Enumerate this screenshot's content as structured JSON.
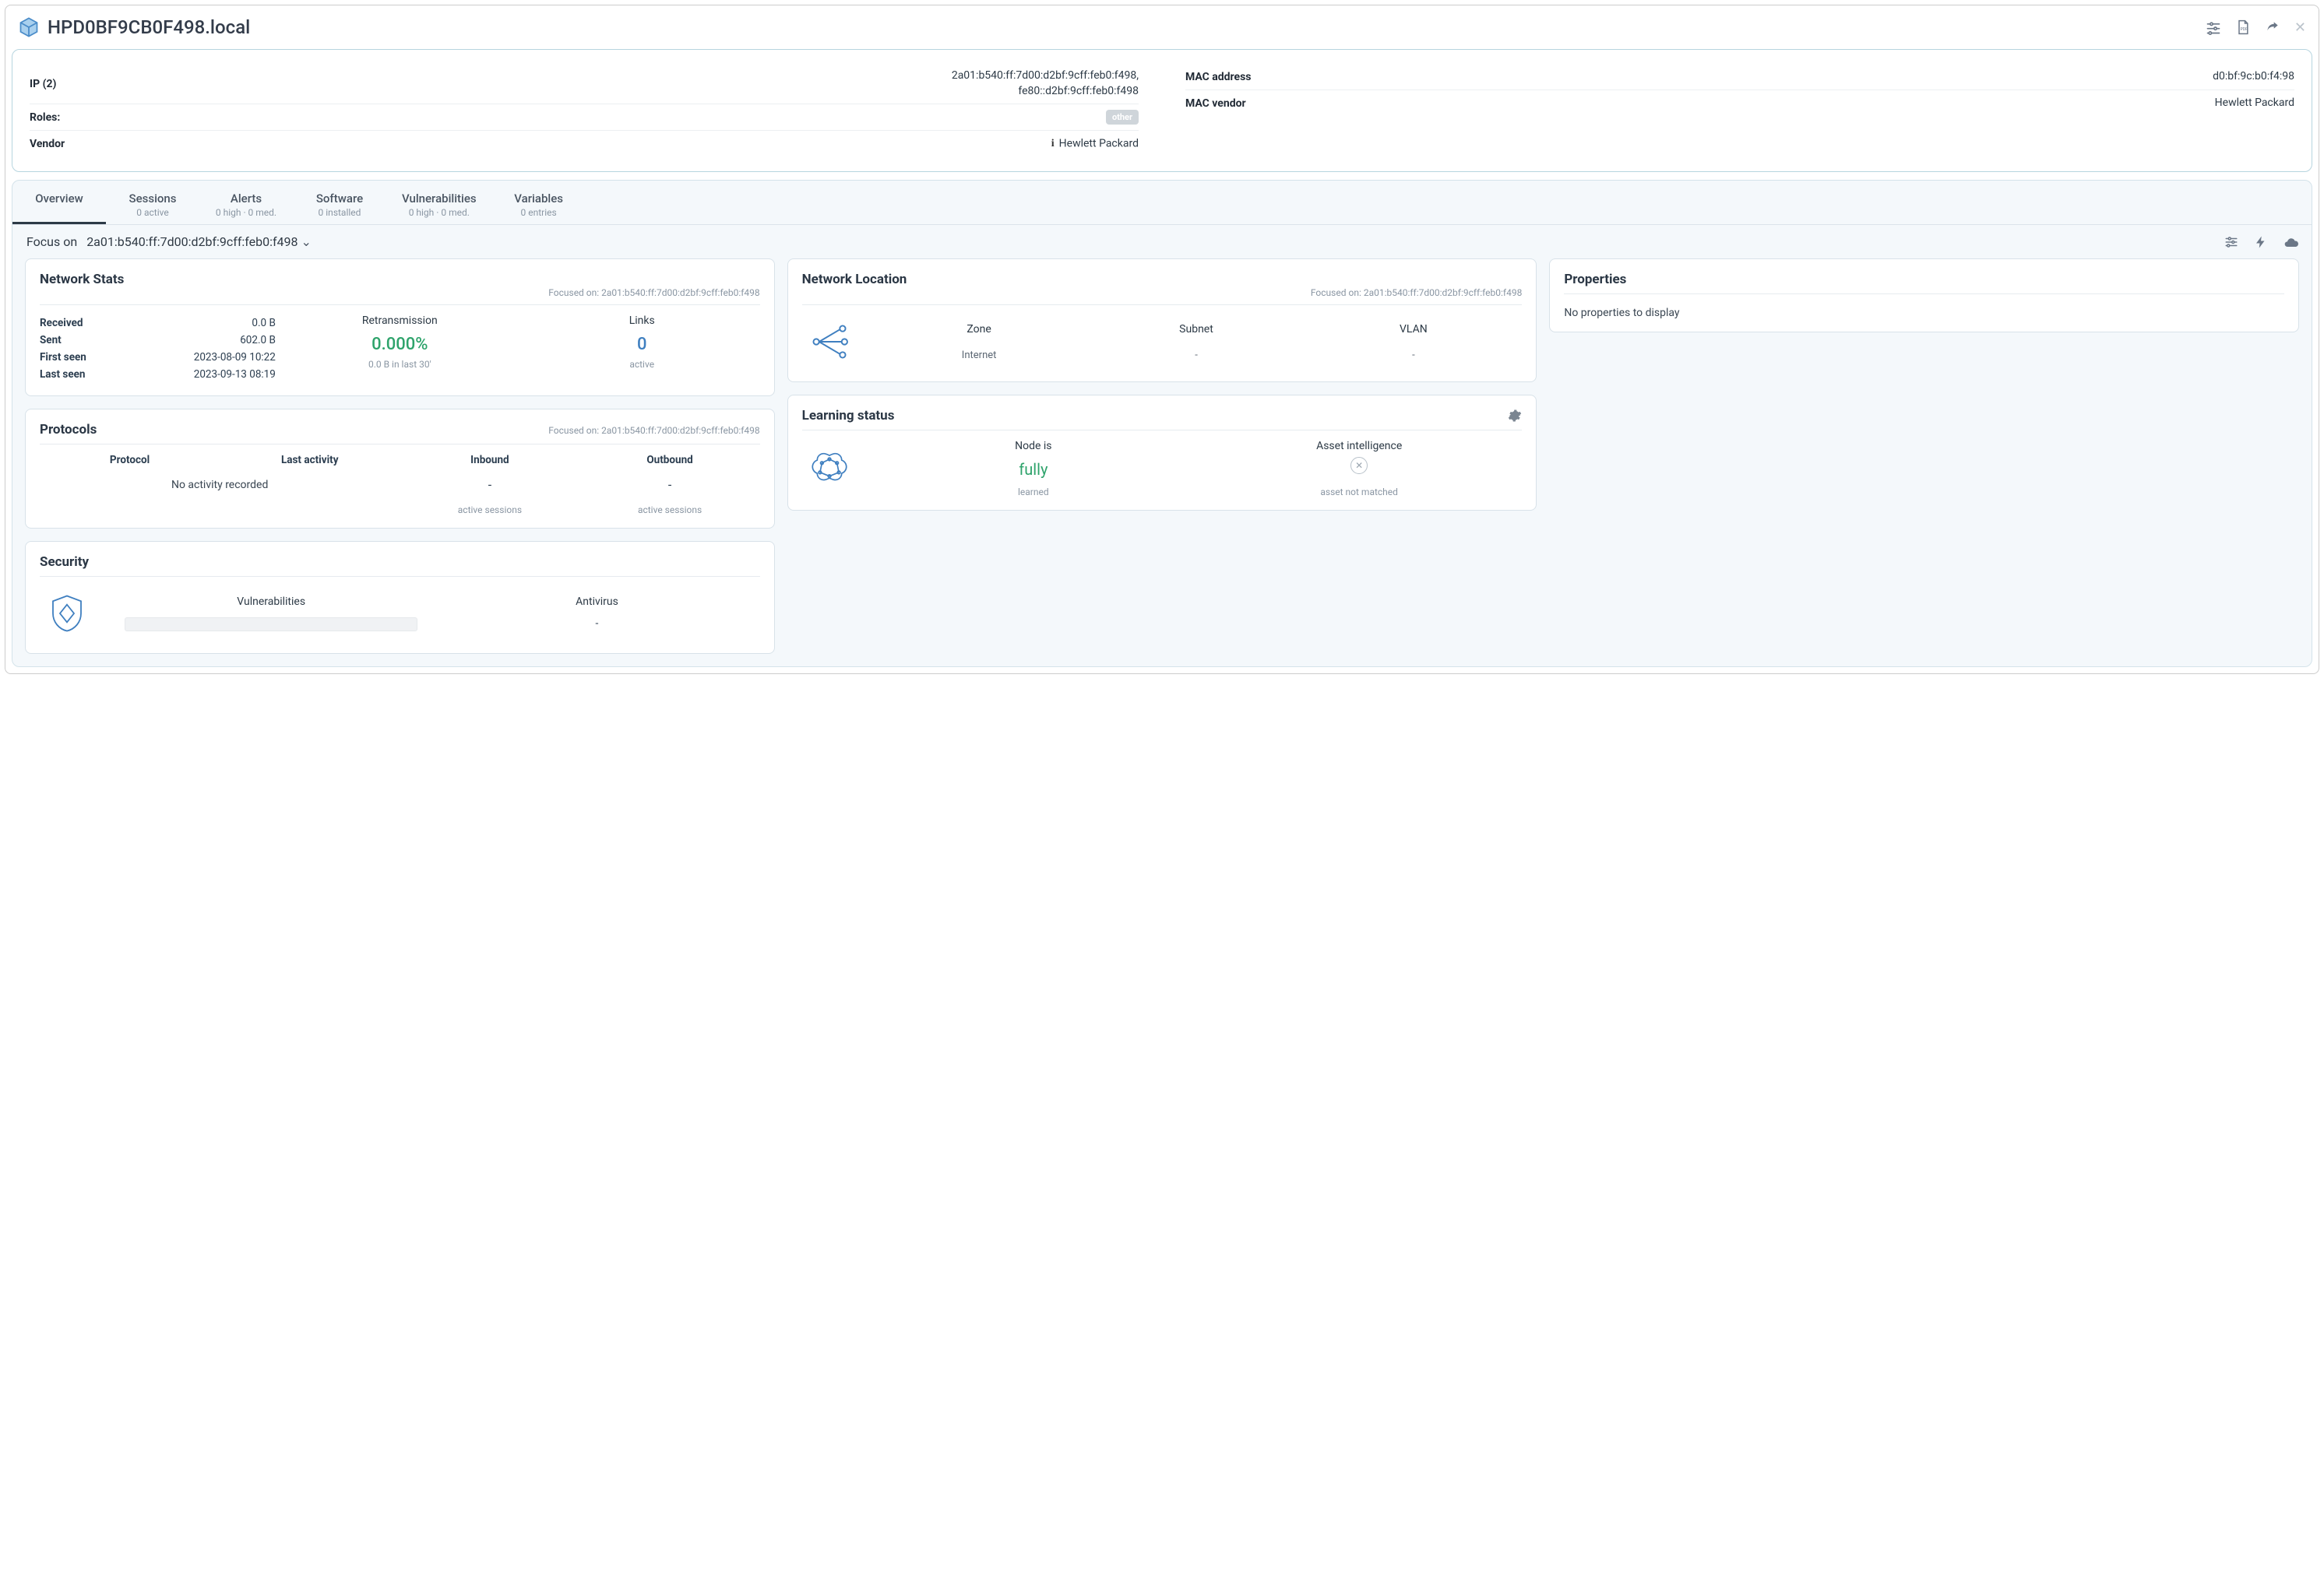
{
  "header": {
    "title": "HPD0BF9CB0F498.local"
  },
  "info": {
    "ip_label": "IP (2)",
    "ip_value": "2a01:b540:ff:7d00:d2bf:9cff:feb0:f498,\nfe80::d2bf:9cff:feb0:f498",
    "roles_label": "Roles:",
    "roles_badge": "other",
    "vendor_label": "Vendor",
    "vendor_value": "Hewlett Packard",
    "mac_addr_label": "MAC address",
    "mac_addr_value": "d0:bf:9c:b0:f4:98",
    "mac_vendor_label": "MAC vendor",
    "mac_vendor_value": "Hewlett Packard"
  },
  "tabs": {
    "overview": {
      "label": "Overview",
      "sub": ""
    },
    "sessions": {
      "label": "Sessions",
      "sub": "0 active"
    },
    "alerts": {
      "label": "Alerts",
      "sub": "0 high · 0 med."
    },
    "software": {
      "label": "Software",
      "sub": "0 installed"
    },
    "vulns": {
      "label": "Vulnerabilities",
      "sub": "0 high · 0 med."
    },
    "vars": {
      "label": "Variables",
      "sub": "0 entries"
    }
  },
  "focus": {
    "label": "Focus on",
    "value": "2a01:b540:ff:7d00:d2bf:9cff:feb0:f498"
  },
  "network_stats": {
    "title": "Network Stats",
    "focused": "Focused on: 2a01:b540:ff:7d00:d2bf:9cff:feb0:f498",
    "received_k": "Received",
    "received_v": "0.0 B",
    "sent_k": "Sent",
    "sent_v": "602.0 B",
    "first_k": "First seen",
    "first_v": "2023-08-09 10:22",
    "last_k": "Last seen",
    "last_v": "2023-09-13 08:19",
    "retrans_k": "Retransmission",
    "retrans_v": "0.000%",
    "retrans_sub": "0.0 B in last 30'",
    "links_k": "Links",
    "links_v": "0",
    "links_sub": "active"
  },
  "network_location": {
    "title": "Network Location",
    "focused": "Focused on: 2a01:b540:ff:7d00:d2bf:9cff:feb0:f498",
    "zone_k": "Zone",
    "zone_v": "Internet",
    "subnet_k": "Subnet",
    "subnet_v": "-",
    "vlan_k": "VLAN",
    "vlan_v": "-"
  },
  "properties": {
    "title": "Properties",
    "empty": "No properties to display"
  },
  "protocols": {
    "title": "Protocols",
    "focused": "Focused on: 2a01:b540:ff:7d00:d2bf:9cff:feb0:f498",
    "col_protocol": "Protocol",
    "col_activity": "Last activity",
    "col_inbound": "Inbound",
    "col_outbound": "Outbound",
    "no_activity": "No activity recorded",
    "dash": "-",
    "sessions_sub": "active sessions"
  },
  "learning": {
    "title": "Learning status",
    "node_k": "Node is",
    "node_v": "fully",
    "node_sub": "learned",
    "ai_k": "Asset intelligence",
    "ai_sub": "asset not matched"
  },
  "security": {
    "title": "Security",
    "vuln_k": "Vulnerabilities",
    "av_k": "Antivirus",
    "av_v": "-"
  }
}
